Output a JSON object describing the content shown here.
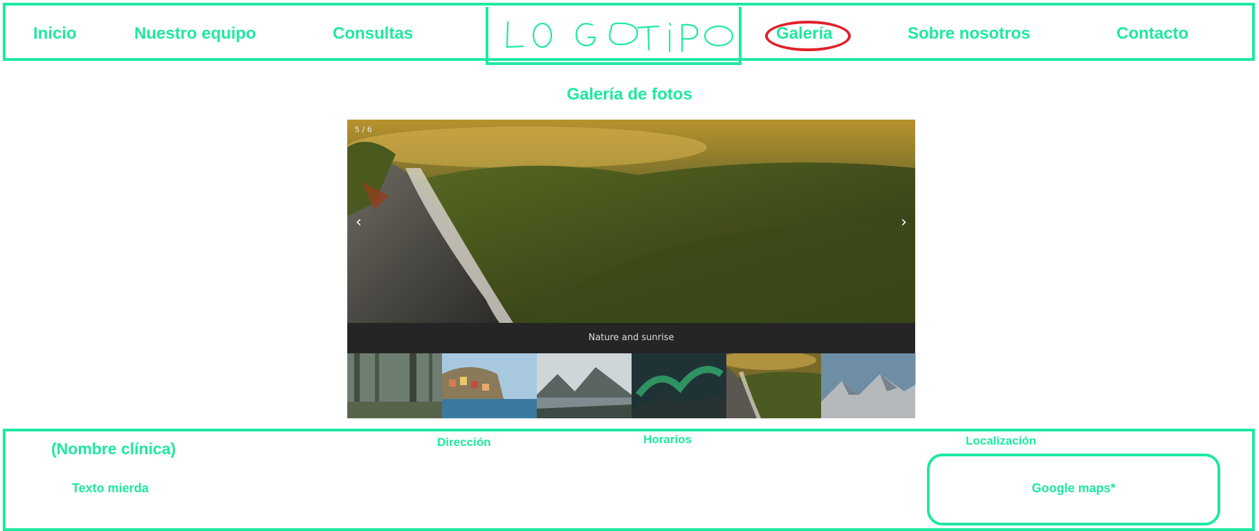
{
  "header": {
    "nav_left": [
      "Inicio",
      "Nuestro equipo",
      "Consultas"
    ],
    "logo_text": "LOG OTIPO",
    "nav_right": [
      "Galería",
      "Sobre nosotros",
      "Contacto"
    ],
    "active_item": "Galería"
  },
  "gallery": {
    "title": "Galería de fotos",
    "counter": "5 / 6",
    "prev_arrow": "‹",
    "next_arrow": "›",
    "caption": "Nature and sunrise",
    "thumbnails": [
      "forest-icon",
      "coastal-village-icon",
      "mountain-lake-icon",
      "aurora-icon",
      "waterfall-sunrise-icon",
      "snowy-mountains-icon"
    ]
  },
  "footer": {
    "clinic_name": "(Nombre clínica)",
    "address_label": "Dirección",
    "hours_label": "Horarios",
    "location_label": "Localización",
    "body_text": "Texto mierda",
    "map_label": "Google maps*"
  },
  "colors": {
    "accent": "#1de9a0",
    "active_ring": "#e0202a"
  }
}
